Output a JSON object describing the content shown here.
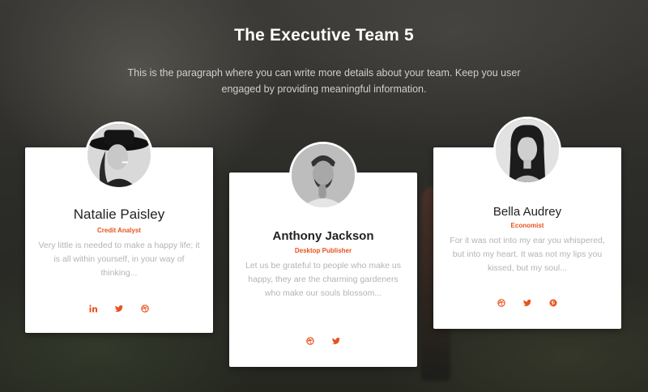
{
  "header": {
    "title": "The Executive Team 5",
    "intro": "This is the paragraph where you can write more details about your team. Keep you user engaged by providing meaningful information."
  },
  "members": [
    {
      "name": "Natalie Paisley",
      "role": "Credit Analyst",
      "bio": "Very little is needed to make a happy life; it is all within yourself, in your way of thinking...",
      "socials": [
        "linkedin-icon",
        "twitter-icon",
        "dribbble-icon"
      ]
    },
    {
      "name": "Anthony Jackson",
      "role": "Desktop Publisher",
      "bio": "Let us be grateful to people who make us happy, they are the charming gardeners who make our souls blossom...",
      "socials": [
        "dribbble-icon",
        "twitter-icon"
      ]
    },
    {
      "name": "Bella Audrey",
      "role": "Economist",
      "bio": "For it was not into my ear you whispered, but into my heart. It was not my lips you kissed, but my soul...",
      "socials": [
        "dribbble-icon",
        "twitter-icon",
        "pinterest-icon"
      ]
    }
  ],
  "colors": {
    "accent": "#e8521e",
    "card": "#ffffff",
    "muted_text": "#b4b4b4"
  }
}
